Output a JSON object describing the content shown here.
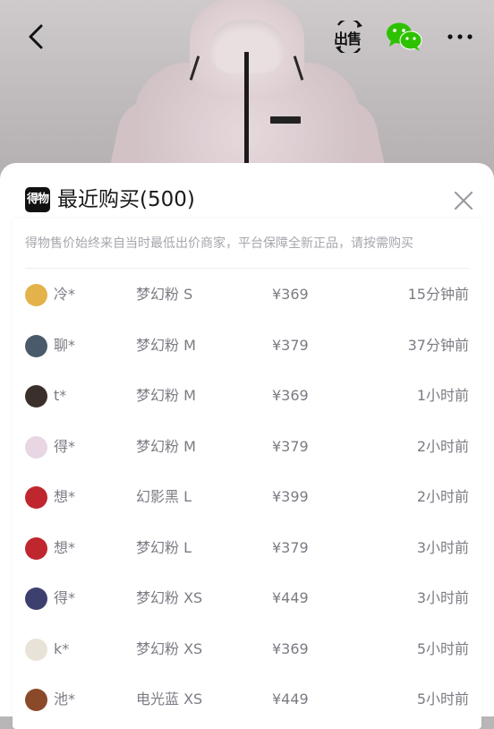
{
  "nav": {
    "back_icon": "chevron-left-icon",
    "sell_label": "出售",
    "share_icon": "wechat-icon",
    "more_icon": "more-horizontal-icon"
  },
  "sheet": {
    "logo_text": "得物",
    "title": "最近购买(500)",
    "close_icon": "close-icon",
    "notice": "得物售价始终来自当时最低出价商家，平台保障全新正品，请按需购买"
  },
  "purchases": [
    {
      "buyer": "冷*",
      "spec": "梦幻粉 S",
      "price": "¥369",
      "time": "15分钟前",
      "avatar_color": "#e3b24a"
    },
    {
      "buyer": "聊*",
      "spec": "梦幻粉 M",
      "price": "¥379",
      "time": "37分钟前",
      "avatar_color": "#4a5a6a"
    },
    {
      "buyer": "t*",
      "spec": "梦幻粉 M",
      "price": "¥369",
      "time": "1小时前",
      "avatar_color": "#3a2f2a"
    },
    {
      "buyer": "得*",
      "spec": "梦幻粉 M",
      "price": "¥379",
      "time": "2小时前",
      "avatar_color": "#e8d6e4"
    },
    {
      "buyer": "想*",
      "spec": "幻影黑 L",
      "price": "¥399",
      "time": "2小时前",
      "avatar_color": "#c0262e"
    },
    {
      "buyer": "想*",
      "spec": "梦幻粉 L",
      "price": "¥379",
      "time": "3小时前",
      "avatar_color": "#c0262e"
    },
    {
      "buyer": "得*",
      "spec": "梦幻粉 XS",
      "price": "¥449",
      "time": "3小时前",
      "avatar_color": "#3d3f6e"
    },
    {
      "buyer": "k*",
      "spec": "梦幻粉 XS",
      "price": "¥369",
      "time": "5小时前",
      "avatar_color": "#e9e2d8"
    },
    {
      "buyer": "池*",
      "spec": "电光蓝 XS",
      "price": "¥449",
      "time": "5小时前",
      "avatar_color": "#8a4a2a"
    }
  ]
}
